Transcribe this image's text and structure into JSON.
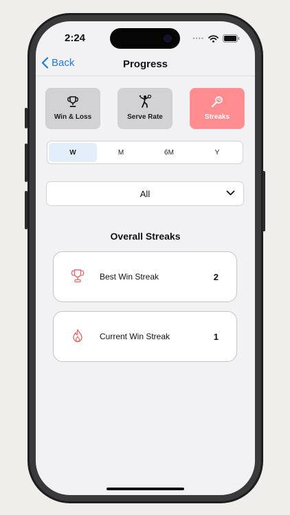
{
  "status": {
    "time": "2:24"
  },
  "nav": {
    "back_label": "Back",
    "title": "Progress"
  },
  "tiles": [
    {
      "label": "Win & Loss",
      "icon": "trophy-icon",
      "active": false
    },
    {
      "label": "Serve Rate",
      "icon": "tennis-serve-icon",
      "active": false
    },
    {
      "label": "Streaks",
      "icon": "tennis-racket-icon",
      "active": true
    }
  ],
  "period": {
    "options": [
      "W",
      "M",
      "6M",
      "Y"
    ],
    "selected": "W"
  },
  "filter": {
    "value": "All"
  },
  "section": {
    "title": "Overall Streaks"
  },
  "streaks": [
    {
      "label": "Best Win Streak",
      "value": "2",
      "icon": "trophy-icon"
    },
    {
      "label": "Current Win Streak",
      "value": "1",
      "icon": "flame-icon"
    }
  ],
  "colors": {
    "accent": "#ff8c8f",
    "link": "#1e7ad8",
    "icon_red": "#e86a6d"
  }
}
